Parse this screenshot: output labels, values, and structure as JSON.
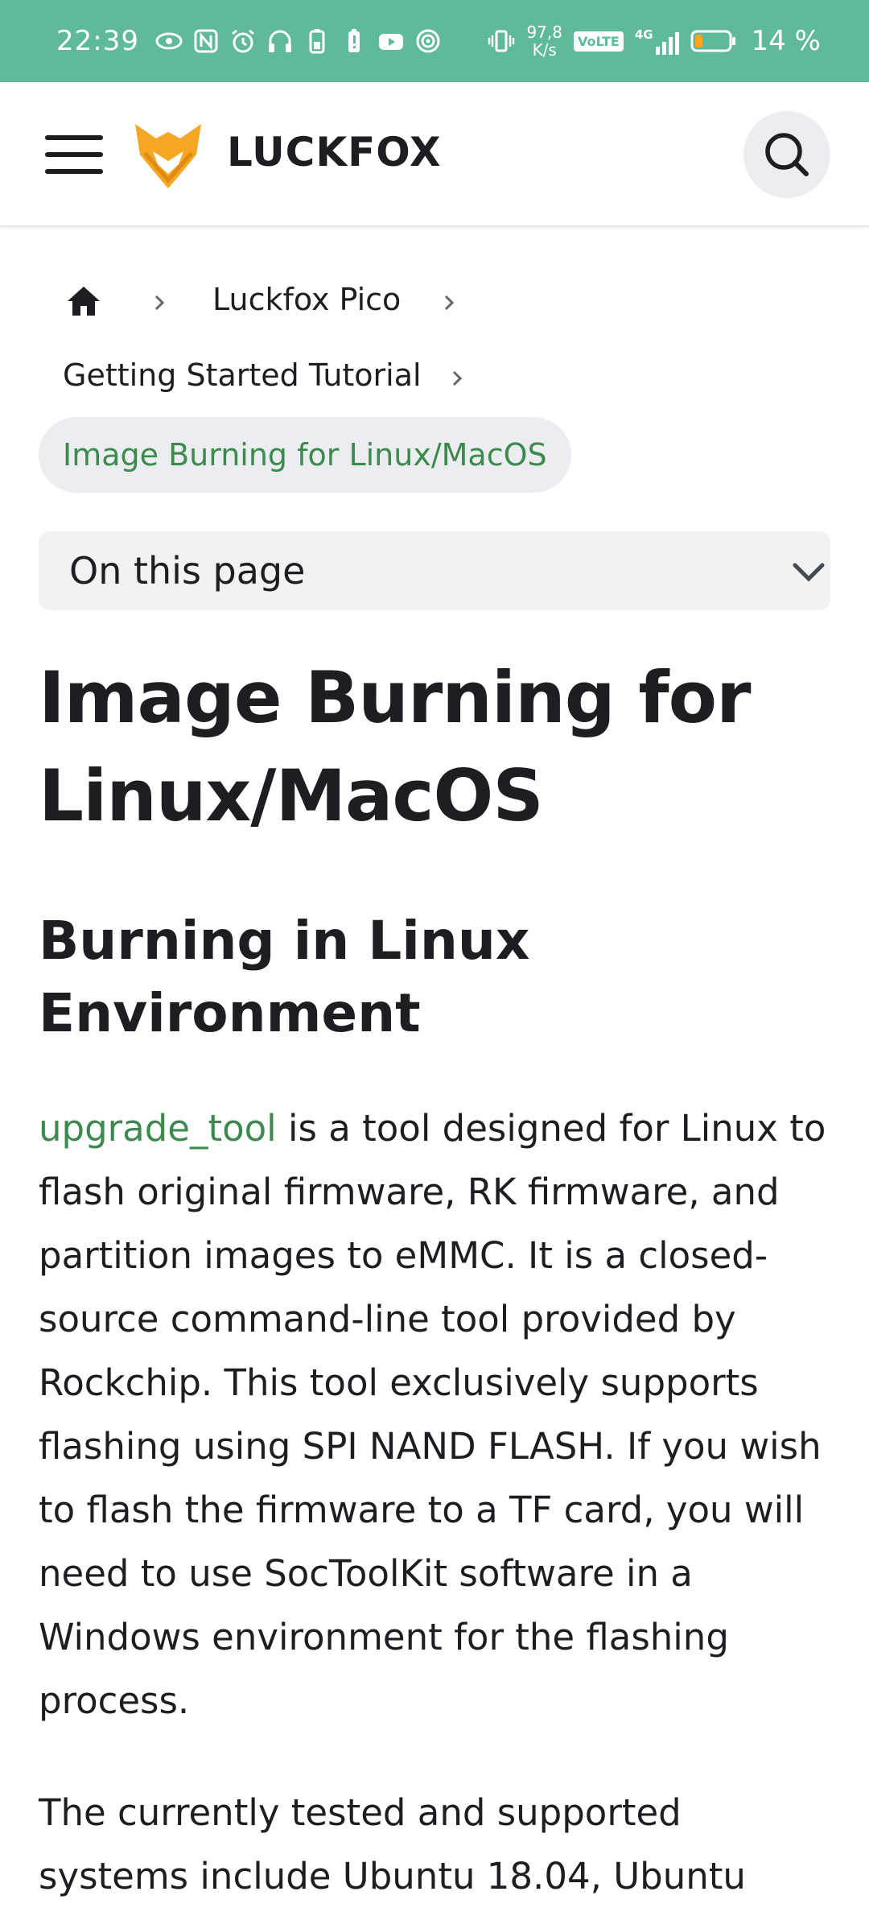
{
  "status_bar": {
    "time": "22:39",
    "net_speed_value": "97,8",
    "net_speed_unit": "K/s",
    "volte": "VoLTE",
    "network": "4G",
    "battery_percent": "14 %",
    "left_icons": [
      "eye-icon",
      "nfc-icon",
      "alarm-icon",
      "headphones-icon",
      "battery-saver-icon",
      "battery-alert-icon",
      "youtube-icon",
      "hotspot-icon"
    ]
  },
  "navbar": {
    "brand": "LUCKFOX"
  },
  "breadcrumb": {
    "items": [
      "Luckfox Pico",
      "Getting Started Tutorial"
    ],
    "active": "Image Burning for Linux/MacOS"
  },
  "toc": {
    "label": "On this page"
  },
  "article": {
    "title_line1": "Image Burning for",
    "title_line2": "Linux/MacOS",
    "section_line1": "Burning in Linux",
    "section_line2": "Environment",
    "link_text": "upgrade_tool",
    "paragraph1_rest": " is a tool designed for Linux to flash original firmware, RK firmware, and partition images to eMMC. It is a closed-source command-line tool provided by Rockchip. This tool exclusively supports flashing using SPI NAND FLASH. If you wish to flash the firmware to a TF card, you will need to use SocToolKit software in a Windows environment for the flashing process.",
    "paragraph2_line1": "The currently tested and supported",
    "paragraph2_line2": "systems include Ubuntu 18.04, Ubuntu"
  },
  "colors": {
    "status_bar_bg": "#5fba9c",
    "accent_green": "#3d8a4f",
    "logo_orange": "#f5a623"
  }
}
